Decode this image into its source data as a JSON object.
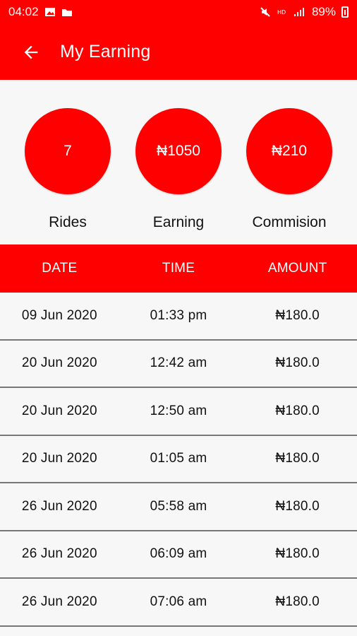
{
  "status": {
    "time": "04:02",
    "battery": "89%"
  },
  "appbar": {
    "title": "My Earning"
  },
  "stats": [
    {
      "value": "7",
      "label": "Rides"
    },
    {
      "value": "₦1050",
      "label": "Earning"
    },
    {
      "value": "₦210",
      "label": "Commision"
    }
  ],
  "table": {
    "headers": [
      "DATE",
      "TIME",
      "AMOUNT"
    ],
    "rows": [
      [
        "09 Jun 2020",
        "01:33 pm",
        "₦180.0"
      ],
      [
        "20 Jun 2020",
        "12:42 am",
        "₦180.0"
      ],
      [
        "20 Jun 2020",
        "12:50 am",
        "₦180.0"
      ],
      [
        "20 Jun 2020",
        "01:05 am",
        "₦180.0"
      ],
      [
        "26 Jun 2020",
        "05:58 am",
        "₦180.0"
      ],
      [
        "26 Jun 2020",
        "06:09 am",
        "₦180.0"
      ],
      [
        "26 Jun 2020",
        "07:06 am",
        "₦180.0"
      ]
    ]
  }
}
